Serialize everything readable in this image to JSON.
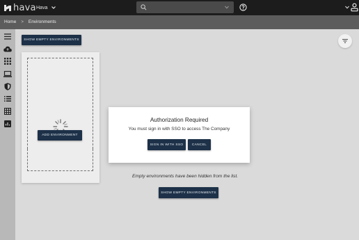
{
  "brand": {
    "name": "hava"
  },
  "header": {
    "org_name": "Hava",
    "search": {
      "value": "",
      "placeholder": ""
    }
  },
  "breadcrumb": {
    "items": [
      "Home",
      "Environments"
    ],
    "separator": ">"
  },
  "toolbar": {
    "show_empty_label": "SHOW EMPTY ENVIRONMENTS"
  },
  "env_card": {
    "add_label": "ADD ENVIRONMENT"
  },
  "modal": {
    "title": "Authorization Required",
    "message": "You must sign in with SSO to access The Company",
    "sso_label": "SIGN IN WITH SSO",
    "cancel_label": "CANCEL"
  },
  "empty_note": {
    "text": "Empty environments have been hidden from the list.",
    "button_label": "SHOW EMPTY ENVIRONMENTS"
  },
  "nav_icons": [
    "menu-icon",
    "cloud-upload-icon",
    "grid-apps-icon",
    "laptop-icon",
    "shield-icon",
    "list-icon",
    "table-icon",
    "chart-icon"
  ],
  "colors": {
    "topbar": "#1c1c1c",
    "breadcrumb_bar": "#5c5c5c",
    "button": "#1d3148",
    "background": "#dadada"
  }
}
